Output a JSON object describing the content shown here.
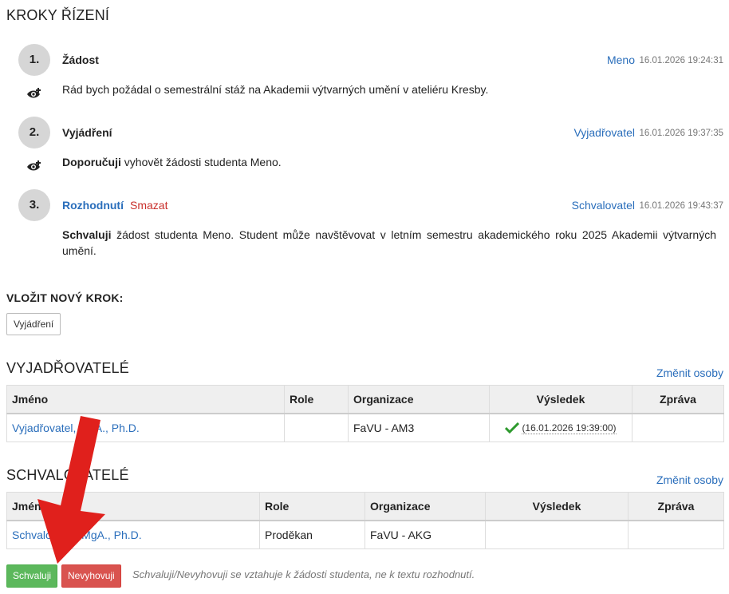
{
  "steps_section": {
    "title": "KROKY ŘÍZENÍ"
  },
  "steps": [
    {
      "number": "1.",
      "title": "Žádost",
      "person": "Meno",
      "timestamp": "16.01.2026 19:24:31",
      "text_bold": "",
      "text": "Rád bych požádal o semestrální stáž na Akademii výtvarných umění v ateliéru Kresby."
    },
    {
      "number": "2.",
      "title": "Vyjádření",
      "person": "Vyjadřovatel",
      "timestamp": "16.01.2026 19:37:35",
      "text_bold": "Doporučuji",
      "text": " vyhovět žádosti studenta Meno."
    },
    {
      "number": "3.",
      "title": "Rozhodnutí",
      "delete_label": "Smazat",
      "person": "Schvalovatel",
      "timestamp": "16.01.2026 19:43:37",
      "text_bold": "Schvaluji",
      "text_line1": " žádost studenta Meno. Student může navštěvovat v letním semestru akademického roku 2025 Akademii výtvarných",
      "text_line2": "umění."
    }
  ],
  "new_step": {
    "title": "VLOŽIT NOVÝ KROK:",
    "button_label": "Vyjádření"
  },
  "reviewers": {
    "title": "VYJADŘOVATELÉ",
    "change_link": "Změnit osoby",
    "columns": [
      "Jméno",
      "Role",
      "Organizace",
      "Výsledek",
      "Zpráva"
    ],
    "rows": [
      {
        "name": "Vyjadřovatel, MgA., Ph.D.",
        "role": "",
        "organization": "FaVU - AM3",
        "result": "(16.01.2026 19:39:00)",
        "message": ""
      }
    ]
  },
  "approvers": {
    "title": "SCHVALOVATELÉ",
    "change_link": "Změnit osoby",
    "columns": [
      "Jméno",
      "Role",
      "Organizace",
      "Výsledek",
      "Zpráva"
    ],
    "rows": [
      {
        "name": "Schvalovatel, MgA., Ph.D.",
        "role": "Proděkan",
        "organization": "FaVU - AKG",
        "result": "",
        "message": ""
      }
    ]
  },
  "actions": {
    "approve_label": "Schvaluji",
    "reject_label": "Nevyhovuji",
    "note": "Schvaluji/Nevyhovuji se vztahuje k žádosti studenta, ne k textu rozhodnutí."
  },
  "colors": {
    "link": "#2a6ebb",
    "danger": "#c9302c",
    "success": "#5cb85c",
    "arrow": "#e0201c"
  }
}
